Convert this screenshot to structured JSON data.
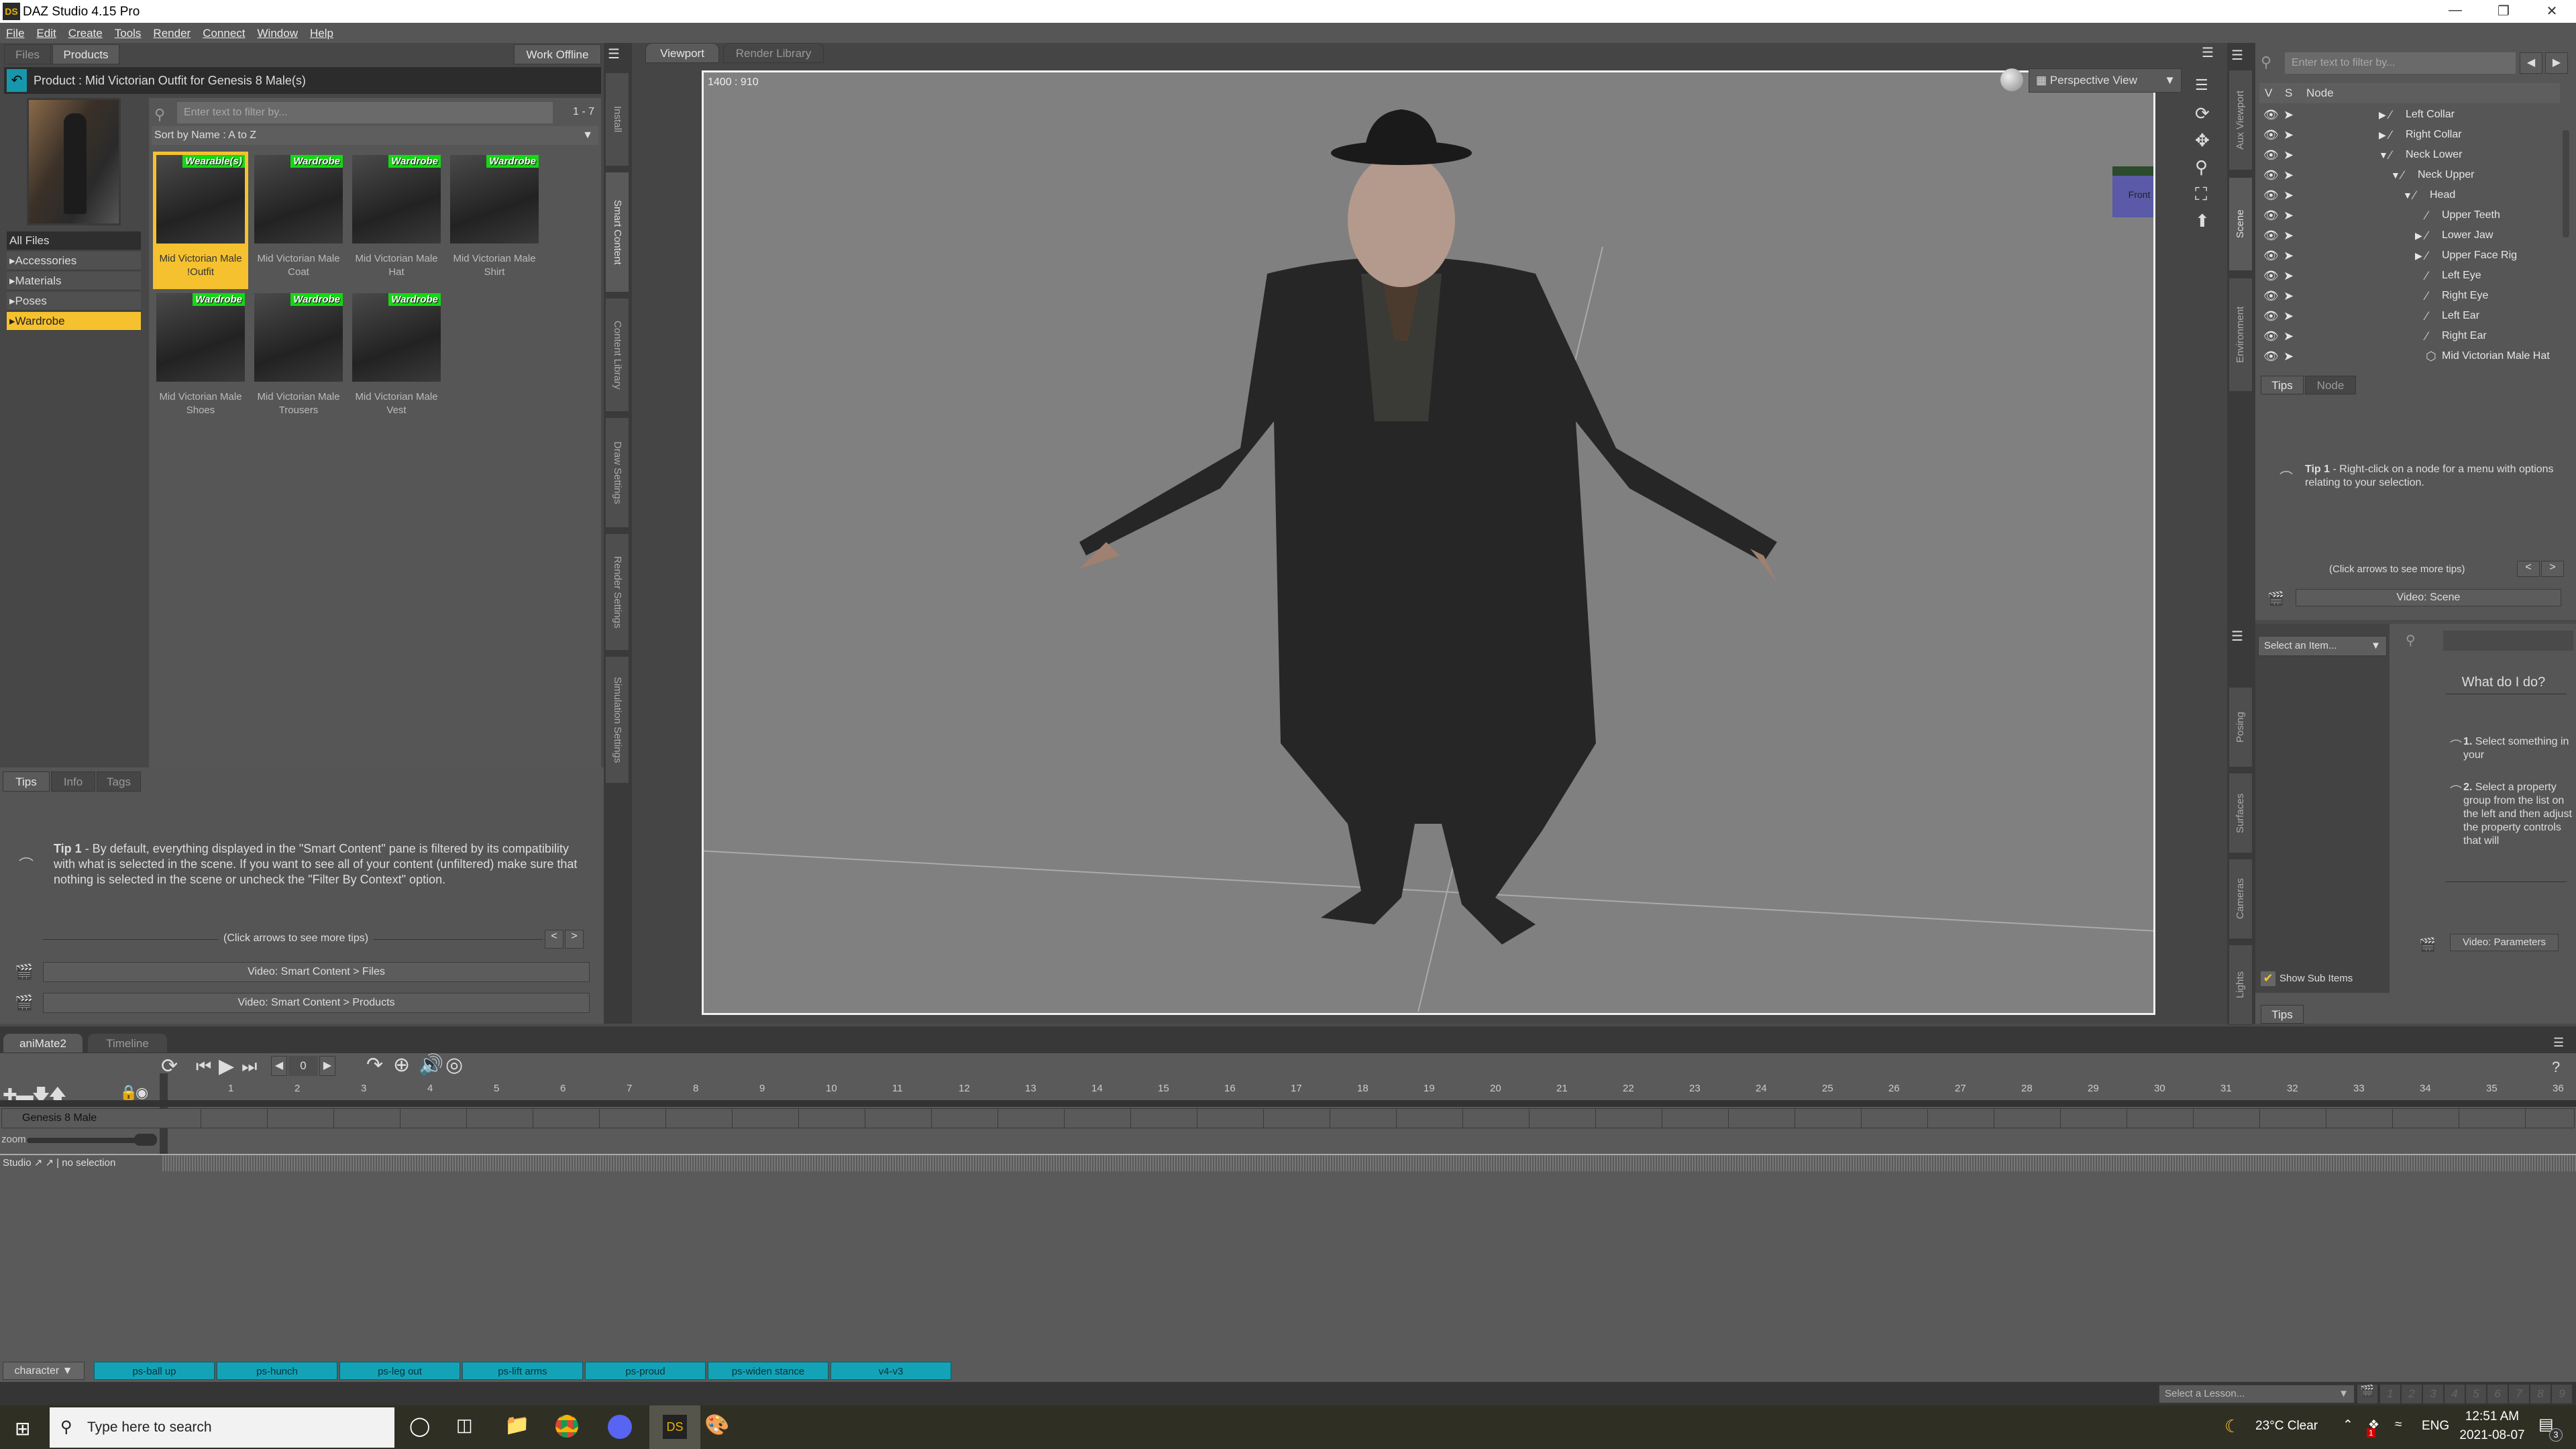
{
  "window": {
    "title": "DAZ Studio 4.15 Pro",
    "logo": "DS"
  },
  "menu": [
    "File",
    "Edit",
    "Create",
    "Tools",
    "Render",
    "Connect",
    "Window",
    "Help"
  ],
  "left_panel": {
    "tabs": [
      "Files",
      "Products"
    ],
    "active_tab": "Products",
    "work_offline": "Work Offline",
    "product_label": "Product : Mid Victorian Outfit for Genesis 8 Male(s)",
    "filter_placeholder": "Enter text to filter by...",
    "count": "1 - 7",
    "sort": "Sort by Name : A to Z",
    "categories": [
      {
        "label": "All Files",
        "expand": false
      },
      {
        "label": "Accessories",
        "expand": true
      },
      {
        "label": "Materials",
        "expand": true
      },
      {
        "label": "Poses",
        "expand": true
      },
      {
        "label": "Wardrobe",
        "expand": true,
        "selected": true
      }
    ],
    "items": [
      {
        "badge": "Wearable(s)",
        "label": "Mid Victorian Male !Outfit",
        "selected": true
      },
      {
        "badge": "Wardrobe",
        "label": "Mid Victorian Male Coat"
      },
      {
        "badge": "Wardrobe",
        "label": "Mid Victorian Male Hat"
      },
      {
        "badge": "Wardrobe",
        "label": "Mid Victorian Male Shirt"
      },
      {
        "badge": "Wardrobe",
        "label": "Mid Victorian Male Shoes"
      },
      {
        "badge": "Wardrobe",
        "label": "Mid Victorian Male Trousers"
      },
      {
        "badge": "Wardrobe",
        "label": "Mid Victorian Male Vest"
      }
    ],
    "info_tabs": [
      "Tips",
      "Info",
      "Tags"
    ],
    "tip_bold": "Tip 1",
    "tip_text": " - By default, everything displayed in the \"Smart Content\" pane is filtered by its compatibility with what is selected in the scene. If you want to see all of your content (unfiltered) make sure that nothing is selected in the scene or uncheck the \"Filter By Context\" option.",
    "more_tips": "(Click arrows to see more tips)",
    "prev": "<",
    "next": ">",
    "videos": [
      "Video: Smart Content > Files",
      "Video: Smart Content > Products"
    ]
  },
  "left_vtabs": [
    "Install",
    "Smart Content",
    "Content Library",
    "Draw Settings",
    "Render Settings",
    "Simulation Settings"
  ],
  "viewport": {
    "tabs": [
      "Viewport",
      "Render Library"
    ],
    "resolution": "1400 : 910",
    "view": "Perspective View",
    "cube_label": "Front"
  },
  "right_vtabs_top": [
    "Aux Viewport",
    "Scene",
    "Environment"
  ],
  "right_vtabs_bottom": [
    "Posing",
    "Surfaces",
    "Cameras",
    "Lights"
  ],
  "scene": {
    "filter_placeholder": "Enter text to filter by...",
    "cols": [
      "V",
      "S",
      "Node"
    ],
    "nodes": [
      {
        "label": "Left Collar",
        "depth": 0,
        "arrow": "right",
        "icon": "bone"
      },
      {
        "label": "Right Collar",
        "depth": 0,
        "arrow": "right",
        "icon": "bone"
      },
      {
        "label": "Neck Lower",
        "depth": 0,
        "arrow": "down",
        "icon": "bone"
      },
      {
        "label": "Neck Upper",
        "depth": 1,
        "arrow": "down",
        "icon": "bone"
      },
      {
        "label": "Head",
        "depth": 2,
        "arrow": "down",
        "icon": "bone"
      },
      {
        "label": "Upper Teeth",
        "depth": 3,
        "arrow": "",
        "icon": "bone"
      },
      {
        "label": "Lower Jaw",
        "depth": 3,
        "arrow": "right",
        "icon": "bone"
      },
      {
        "label": "Upper Face Rig",
        "depth": 3,
        "arrow": "right",
        "icon": "bone"
      },
      {
        "label": "Left Eye",
        "depth": 3,
        "arrow": "",
        "icon": "bone"
      },
      {
        "label": "Right Eye",
        "depth": 3,
        "arrow": "",
        "icon": "bone"
      },
      {
        "label": "Left Ear",
        "depth": 3,
        "arrow": "",
        "icon": "bone"
      },
      {
        "label": "Right Ear",
        "depth": 3,
        "arrow": "",
        "icon": "bone"
      },
      {
        "label": "Mid Victorian Male Hat",
        "depth": 3,
        "arrow": "",
        "icon": "cube"
      }
    ],
    "tabs": [
      "Tips",
      "Node"
    ],
    "tip_bold": "Tip 1",
    "tip_text": " - Right-click on a node for a menu with options relating to your selection.",
    "more_tips": "(Click arrows to see more tips)",
    "video": "Video: Scene"
  },
  "params": {
    "select": "Select an Item...",
    "what": "What do I do?",
    "steps": [
      {
        "n": "1.",
        "t": " Select something in your"
      },
      {
        "n": "2.",
        "t": " Select a property group from the list on the left and then adjust the property controls that will"
      }
    ],
    "video": "Video: Parameters",
    "show_sub": "Show Sub Items",
    "show_sub_checked": true,
    "bottom_tab": "Tips"
  },
  "animate": {
    "tabs": [
      "aniMate2",
      "Timeline"
    ],
    "frame": "0",
    "track": "Genesis 8 Male",
    "zoom": "zoom",
    "status": "Studio",
    "selection": "no selection",
    "ticks": [
      1,
      2,
      3,
      4,
      5,
      6,
      7,
      8,
      9,
      10,
      11,
      12,
      13,
      14,
      15,
      16,
      17,
      18,
      19,
      20,
      21,
      22,
      23,
      24,
      25,
      26,
      27,
      28,
      29,
      30,
      31,
      32,
      33,
      34,
      35,
      36
    ],
    "category": "character",
    "buttons": [
      "ps-ball up",
      "ps-hunch",
      "ps-leg out",
      "ps-lift arms",
      "ps-proud",
      "ps-widen stance",
      "v4-v3"
    ],
    "button_color": "#14a3b6",
    "lesson": "Select a Lesson...",
    "lesson_steps": [
      "1",
      "2",
      "3",
      "4",
      "5",
      "6",
      "7",
      "8",
      "9"
    ],
    "help": "?"
  },
  "taskbar": {
    "search_placeholder": "Type here to search",
    "weather": "23°C  Clear",
    "lang": "ENG",
    "time": "12:51 AM",
    "date": "2021-08-07",
    "notifications": "3",
    "dropbox_badge": "1"
  },
  "colors": {
    "accent": "#f5c12e",
    "badge": "#13d813",
    "viewport_bg": "#808080"
  }
}
